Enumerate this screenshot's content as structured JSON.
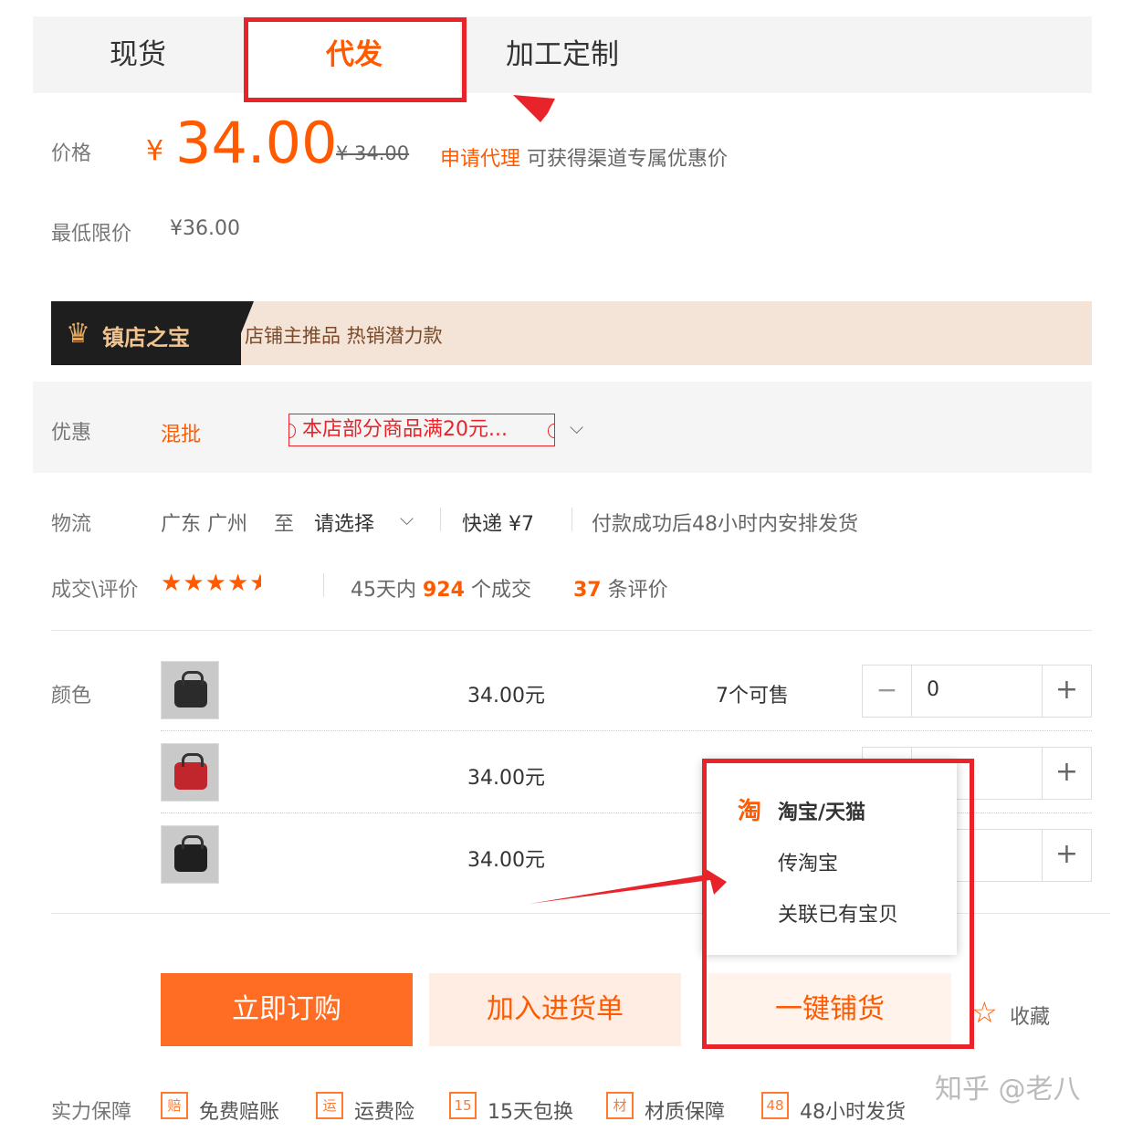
{
  "tabs": [
    {
      "label": "现货"
    },
    {
      "label": "代发"
    },
    {
      "label": "加工定制"
    }
  ],
  "price": {
    "label": "价格",
    "currency": "¥",
    "value": "34.00",
    "original": "¥ 34.00",
    "agent_link": "申请代理",
    "agent_tip": "可获得渠道专属优惠价"
  },
  "min_price": {
    "label": "最低限价",
    "value": "¥36.00"
  },
  "banner": {
    "title": "镇店之宝",
    "subtitle": "店铺主推品  热销潜力款"
  },
  "promo": {
    "label": "优惠",
    "type": "混批",
    "coupon": "本店部分商品满20元..."
  },
  "shipping": {
    "label": "物流",
    "origin": "广东 广州",
    "to": "至",
    "destination": "请选择",
    "method": "快递  ¥7",
    "note": "付款成功后48小时内安排发货"
  },
  "rating": {
    "label": "成交\\评价",
    "stars": 4.5,
    "deals_prefix": "45天内",
    "deals_count": "924",
    "deals_suffix": "个成交",
    "reviews_count": "37",
    "reviews_suffix": "条评价"
  },
  "color": {
    "label": "颜色",
    "rows": [
      {
        "price": "34.00元",
        "stock": "7个可售",
        "qty": "0",
        "bag_color": "#2b2b2b"
      },
      {
        "price": "34.00元",
        "bag_color": "#c0262b"
      },
      {
        "price": "34.00元",
        "bag_color": "#1f1f1f"
      }
    ]
  },
  "popup": {
    "icon": "淘",
    "title": "淘宝/天猫",
    "items": [
      "传淘宝",
      "关联已有宝贝"
    ]
  },
  "actions": {
    "buy": "立即订购",
    "cart": "加入进货单",
    "distribute": "一键铺货",
    "favorite": "收藏"
  },
  "guarantee": {
    "label": "实力保障",
    "items": [
      {
        "icon": "赔",
        "text": "免费赔账"
      },
      {
        "icon": "运",
        "text": "运费险"
      },
      {
        "icon": "15",
        "text": "15天包换"
      },
      {
        "icon": "材",
        "text": "材质保障"
      },
      {
        "icon": "48",
        "text": "48小时发货"
      }
    ]
  },
  "watermark": "知乎 @老八",
  "colors": {
    "accent": "#ff5a00",
    "annotation_red": "#e8242a"
  }
}
